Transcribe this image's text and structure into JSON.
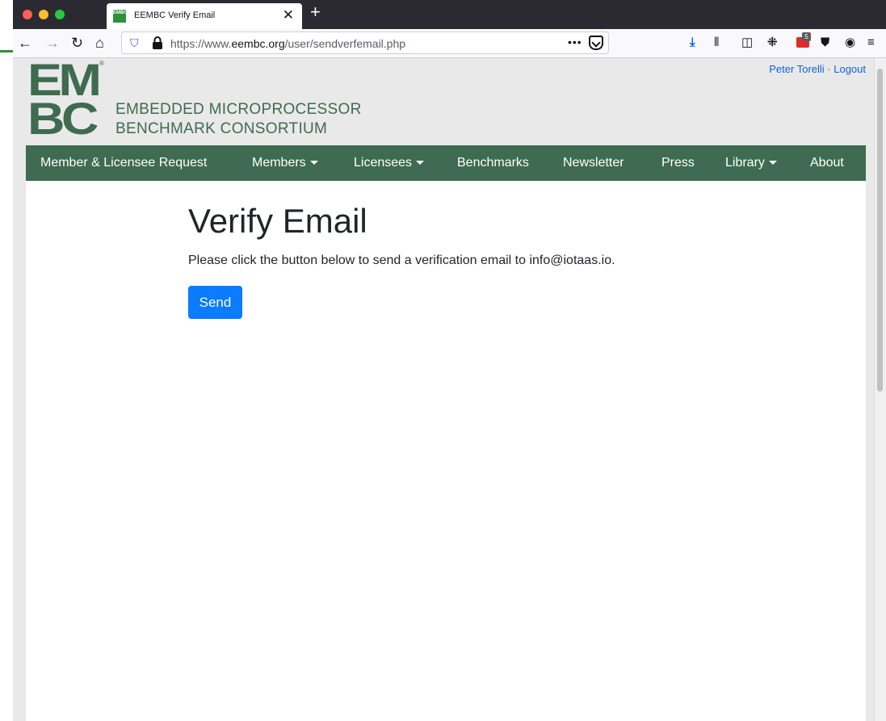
{
  "browser": {
    "tab_title": "EEMBC Verify Email",
    "favicon_text": "EMBC",
    "url_prefix": "https://www.",
    "url_domain": "eembc.org",
    "url_path": "/user/sendverfemail.php",
    "url_more": "•••",
    "extension_badge_count": "5"
  },
  "site": {
    "logo_top": "EM",
    "logo_bottom": "BC",
    "logo_registered": "®",
    "logo_line1": "EMBEDDED MICROPROCESSOR",
    "logo_line2": "BENCHMARK CONSORTIUM",
    "user_name": "Peter Torelli",
    "user_separator": " · ",
    "logout": "Logout",
    "brand_color": "#3e6b51",
    "link_color": "#0b63d5"
  },
  "nav": {
    "items": [
      {
        "label": "Member & Licensee Request"
      },
      {
        "label": "Members"
      },
      {
        "label": "Licensees"
      },
      {
        "label": "Benchmarks"
      },
      {
        "label": "Newsletter"
      },
      {
        "label": "Press"
      },
      {
        "label": "Library"
      },
      {
        "label": "About"
      }
    ]
  },
  "main": {
    "title": "Verify Email",
    "message": "Please click the button below to send a verification email to info@iotaas.io.",
    "send_label": "Send",
    "button_color": "#0b7bff"
  }
}
